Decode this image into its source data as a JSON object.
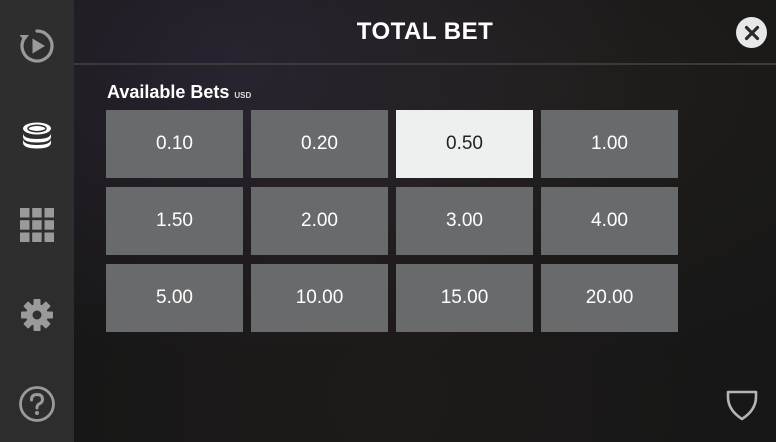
{
  "header": {
    "title": "TOTAL BET"
  },
  "sidebar": {
    "items": [
      {
        "icon": "autoplay-icon"
      },
      {
        "icon": "coins-icon",
        "active": true
      },
      {
        "icon": "paytable-grid-icon"
      },
      {
        "icon": "gear-icon"
      },
      {
        "icon": "help-icon"
      }
    ]
  },
  "bets": {
    "label": "Available Bets",
    "currency": "USD",
    "selected": "0.50",
    "options": [
      "0.10",
      "0.20",
      "0.50",
      "1.00",
      "1.50",
      "2.00",
      "3.00",
      "4.00",
      "5.00",
      "10.00",
      "15.00",
      "20.00"
    ]
  },
  "colors": {
    "button_bg": "#696a6c",
    "selected_bg": "#eef0ef",
    "sidebar_bg": "#303030",
    "text": "#ffffff"
  }
}
